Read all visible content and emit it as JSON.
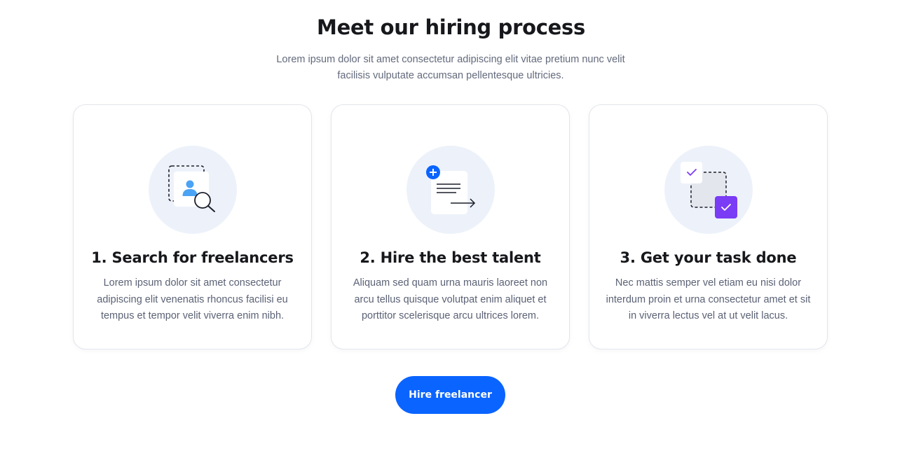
{
  "section": {
    "title": "Meet our hiring process",
    "subtitle": "Lorem ipsum dolor sit amet consectetur adipiscing elit vitae pretium nunc velit facilisis vulputate accumsan pellentesque ultricies."
  },
  "steps": [
    {
      "icon": "search-freelancer-icon",
      "title": "1. Search for freelancers",
      "text": "Lorem ipsum dolor sit amet consectetur adipiscing elit venenatis rhoncus facilisi eu tempus et tempor velit viverra enim nibh."
    },
    {
      "icon": "hire-document-icon",
      "title": "2. Hire the best talent",
      "text": "Aliquam sed quam urna mauris laoreet non arcu tellus quisque volutpat enim aliquet et porttitor scelerisque arcu ultrices lorem."
    },
    {
      "icon": "task-done-icon",
      "title": "3. Get your task done",
      "text": "Nec mattis semper vel etiam eu nisi dolor interdum proin et urna consectetur amet et sit in viverra lectus vel at ut velit lacus."
    }
  ],
  "cta": {
    "label": "Hire freelancer"
  },
  "colors": {
    "accent": "#0a64ff",
    "purple": "#7a3cf5",
    "icon_bg": "#edf2fa",
    "heading": "#17181c",
    "body_text": "#5b6275"
  }
}
